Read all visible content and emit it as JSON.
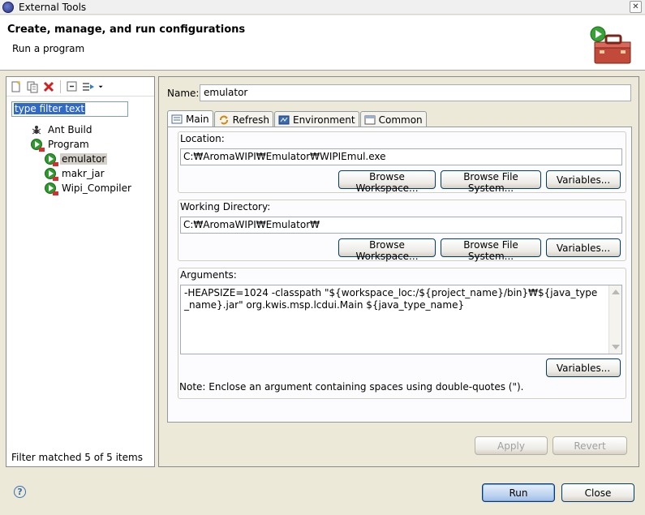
{
  "window": {
    "title": "External Tools",
    "close_glyph": "✕"
  },
  "header": {
    "title": "Create, manage, and run configurations",
    "subtitle": "Run a program",
    "icon": "toolbox-run-icon"
  },
  "left": {
    "toolbar": [
      "new-config-icon",
      "duplicate-icon",
      "delete-icon",
      "collapse-all-icon",
      "filter-icon",
      "dropdown-arrow-icon"
    ],
    "filter_value": "type filter text",
    "tree": [
      {
        "label": "Ant Build",
        "level": 1,
        "icon": "ant-icon",
        "selected": false
      },
      {
        "label": "Program",
        "level": 1,
        "icon": "program-icon",
        "selected": false
      },
      {
        "label": "emulator",
        "level": 2,
        "icon": "program-icon",
        "selected": true
      },
      {
        "label": "makr_jar",
        "level": 2,
        "icon": "program-icon",
        "selected": false
      },
      {
        "label": "Wipi_Compiler",
        "level": 2,
        "icon": "program-icon",
        "selected": false
      }
    ],
    "status": "Filter matched 5 of 5 items"
  },
  "right": {
    "name_label": "Name:",
    "name_value": "emulator",
    "tabs": [
      {
        "label": "Main",
        "icon": "main-tab-icon",
        "active": true
      },
      {
        "label": "Refresh",
        "icon": "refresh-icon",
        "active": false
      },
      {
        "label": "Environment",
        "icon": "environment-icon",
        "active": false
      },
      {
        "label": "Common",
        "icon": "common-icon",
        "active": false
      }
    ],
    "location": {
      "label": "Location:",
      "value": "C:₩AromaWIPI₩Emulator₩WIPIEmul.exe",
      "buttons": [
        "Browse Workspace...",
        "Browse File System...",
        "Variables..."
      ]
    },
    "working_dir": {
      "label": "Working Directory:",
      "value": "C:₩AromaWIPI₩Emulator₩",
      "buttons": [
        "Browse Workspace...",
        "Browse File System...",
        "Variables..."
      ]
    },
    "arguments": {
      "label": "Arguments:",
      "value": "-HEAPSIZE=1024 -classpath \"${workspace_loc:/${project_name}/bin}₩${java_type_name}.jar\" org.kwis.msp.lcdui.Main ${java_type_name}",
      "variables_button": "Variables...",
      "note": "Note: Enclose an argument containing spaces using double-quotes (\")."
    },
    "apply_label": "Apply",
    "revert_label": "Revert"
  },
  "footer": {
    "help_glyph": "?",
    "run_label": "Run",
    "close_label": "Close"
  }
}
